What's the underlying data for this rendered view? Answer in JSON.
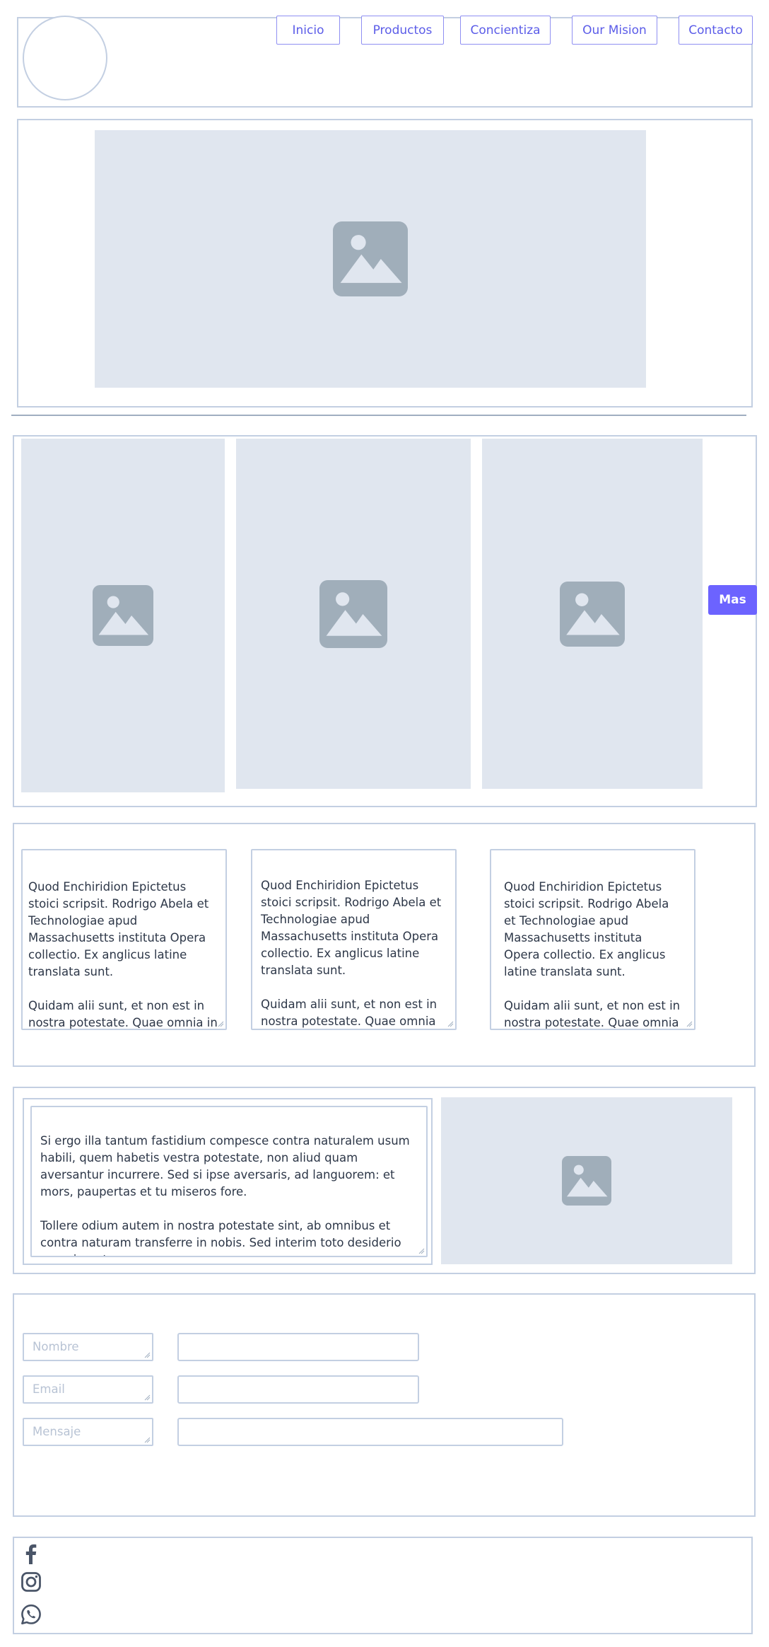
{
  "header": {
    "nav": [
      {
        "label": "Inicio"
      },
      {
        "label": "Productos"
      },
      {
        "label": "Concientiza"
      },
      {
        "label": "Our Mision"
      },
      {
        "label": "Contacto"
      }
    ]
  },
  "gallery": {
    "more_button": "Mas"
  },
  "text_cards": [
    {
      "text": "Quod Enchiridion Epictetus stoici scripsit. Rodrigo Abela et Technologiae apud Massachusetts instituta Opera collectio. Ex anglicus latine translata sunt.\n\nQuidam alii sunt, et non est in nostra potestate. Quae omnia in"
    },
    {
      "text": "Quod Enchiridion Epictetus stoici scripsit. Rodrigo Abela et Technologiae apud Massachusetts instituta Opera collectio. Ex anglicus latine translata sunt.\n\nQuidam alii sunt, et non est in nostra potestate. Quae omnia in"
    },
    {
      "text": "Quod Enchiridion Epictetus stoici scripsit. Rodrigo Abela et Technologiae apud Massachusetts instituta Opera collectio. Ex anglicus latine translata sunt.\n\nQuidam alii sunt, et non est in nostra potestate. Quae omnia in"
    }
  ],
  "feature": {
    "text": "Si ergo illa tantum fastidium compesce contra naturalem usum habili, quem habetis vestra potestate, non aliud quam aversantur incurrere. Sed si ipse aversaris, ad languorem: et mors, paupertas et tu miseros fore.\n\nTollere odium autem in nostra potestate sint, ab omnibus et contra naturam transferre in nobis. Sed interim toto desiderio supprimunt:"
  },
  "contact_form": {
    "name_label": "Nombre",
    "email_label": "Email",
    "message_label": "Mensaje"
  },
  "social": [
    "facebook-icon",
    "instagram-icon",
    "whatsapp-icon"
  ],
  "colors": {
    "accent": "#6c63ff",
    "nav_text": "#5b5ce8",
    "border": "#c3cfe2",
    "placeholder": "#e0e6ef"
  }
}
